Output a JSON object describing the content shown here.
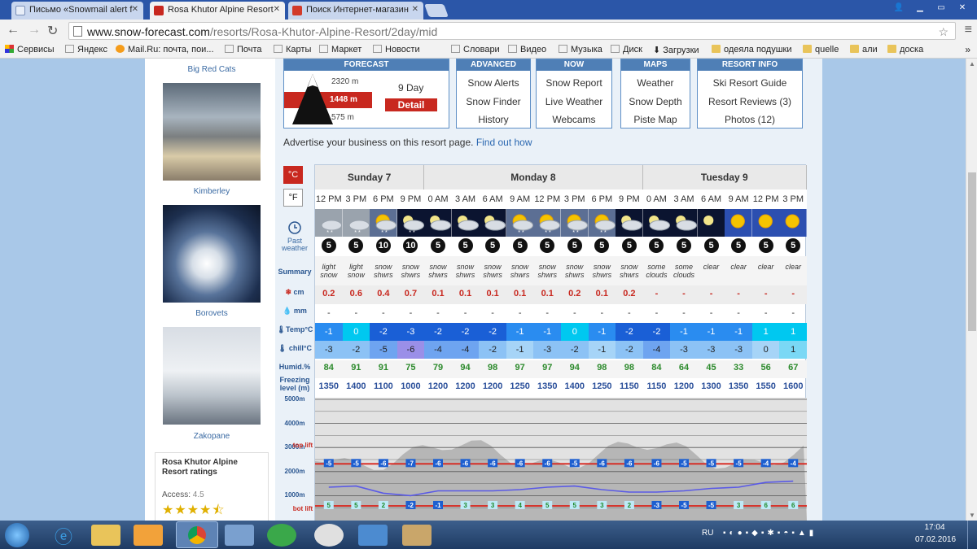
{
  "browser": {
    "tabs": [
      {
        "title": "Письмо «Snowmail alert f",
        "active": false
      },
      {
        "title": "Rosa Khutor Alpine Resort",
        "active": true
      },
      {
        "title": "Поиск Интернет-магазин",
        "active": false
      }
    ],
    "url_host": "www.snow-forecast.com",
    "url_path": "/resorts/Rosa-Khutor-Alpine-Resort/2day/mid",
    "bookmarks": [
      "Сервисы",
      "Яндекс",
      "Mail.Ru: почта, пои...",
      "Почта",
      "Карты",
      "Маркет",
      "Новости",
      "Словари",
      "Видео",
      "Музыка",
      "Диск",
      "Загрузки",
      "одеяла подушки",
      "quelle",
      "али",
      "доска"
    ]
  },
  "sidebar": {
    "links": [
      "Big Red Cats",
      "Kimberley",
      "Borovets",
      "Zakopane"
    ],
    "ratings_title": "Rosa Khutor Alpine Resort ratings",
    "access_label": "Access:",
    "access_value": "4.5",
    "access_stars": 4.5
  },
  "menu": {
    "forecast": {
      "head": "FORECAST",
      "top": "2320 m",
      "mid": "1448 m",
      "bot": "575 m",
      "nine_day": "9 Day",
      "detail": "Detail"
    },
    "advanced": {
      "head": "ADVANCED",
      "items": [
        "Snow Alerts",
        "Snow Finder",
        "History"
      ]
    },
    "now": {
      "head": "NOW",
      "items": [
        "Snow Report",
        "Live Weather",
        "Webcams"
      ]
    },
    "maps": {
      "head": "MAPS",
      "items": [
        "Weather",
        "Snow Depth",
        "Piste Map"
      ]
    },
    "resort_info": {
      "head": "RESORT INFO",
      "items": [
        "Ski Resort Guide",
        "Resort Reviews (3)",
        "Photos (12)"
      ]
    }
  },
  "advert": {
    "text": "Advertise your business on this resort page.",
    "link": "Find out how"
  },
  "units": {
    "celsius": "°C",
    "fahrenheit": "°F"
  },
  "labels": {
    "past_weather": "Past weather",
    "summary": "Summary",
    "snow": "cm",
    "rain": "mm",
    "temp": "Temp°C",
    "chill": "chill°C",
    "humid": "Humid.%",
    "freezing": "Freezing level (m)",
    "top_lift": "top lift",
    "bot_lift": "bot lift"
  },
  "days": [
    {
      "name": "Sunday 7",
      "span": 4
    },
    {
      "name": "Monday 8",
      "span": 8
    },
    {
      "name": "Tuesday 9",
      "span": 6
    }
  ],
  "forecast": {
    "times": [
      "12 PM",
      "3 PM",
      "6 PM",
      "9 PM",
      "0 AM",
      "3 AM",
      "6 AM",
      "9 AM",
      "12 PM",
      "3 PM",
      "6 PM",
      "9 PM",
      "0 AM",
      "3 AM",
      "6 AM",
      "9 AM",
      "12 PM",
      "3 PM"
    ],
    "icons": [
      "cloud-snow",
      "cloud-snow",
      "sun-cloud-snow",
      "moon-cloud-snow",
      "moon-cloud",
      "moon-cloud",
      "moon-cloud",
      "sun-cloud-snow",
      "sun-cloud-snow",
      "sun-cloud-snow",
      "sun-cloud-snow",
      "moon-cloud",
      "moon-cloud",
      "moon-cloud",
      "moon",
      "sun",
      "sun",
      "sun"
    ],
    "wind": [
      "5",
      "5",
      "10",
      "10",
      "5",
      "5",
      "5",
      "5",
      "5",
      "5",
      "5",
      "5",
      "5",
      "5",
      "5",
      "5",
      "5",
      "5"
    ],
    "summary": [
      "light snow",
      "light snow",
      "snow shwrs",
      "snow shwrs",
      "snow shwrs",
      "snow shwrs",
      "snow shwrs",
      "snow shwrs",
      "snow shwrs",
      "snow shwrs",
      "snow shwrs",
      "snow shwrs",
      "some clouds",
      "some clouds",
      "clear",
      "clear",
      "clear",
      "clear"
    ],
    "snow": [
      "0.2",
      "0.6",
      "0.4",
      "0.7",
      "0.1",
      "0.1",
      "0.1",
      "0.1",
      "0.1",
      "0.2",
      "0.1",
      "0.2",
      "-",
      "-",
      "-",
      "-",
      "-",
      "-"
    ],
    "rain": [
      "-",
      "-",
      "-",
      "-",
      "-",
      "-",
      "-",
      "-",
      "-",
      "-",
      "-",
      "-",
      "-",
      "-",
      "-",
      "-",
      "-",
      "-"
    ],
    "temp": [
      "-1",
      "0",
      "-2",
      "-3",
      "-2",
      "-2",
      "-2",
      "-1",
      "-1",
      "0",
      "-1",
      "-2",
      "-2",
      "-1",
      "-1",
      "-1",
      "1",
      "1"
    ],
    "chill": [
      "-3",
      "-2",
      "-5",
      "-6",
      "-4",
      "-4",
      "-2",
      "-1",
      "-3",
      "-2",
      "-1",
      "-2",
      "-4",
      "-3",
      "-3",
      "-3",
      "0",
      "1"
    ],
    "humid": [
      "84",
      "91",
      "91",
      "75",
      "79",
      "94",
      "98",
      "97",
      "97",
      "94",
      "98",
      "98",
      "84",
      "64",
      "45",
      "33",
      "56",
      "67"
    ],
    "freezing": [
      "1350",
      "1400",
      "1100",
      "1000",
      "1200",
      "1200",
      "1200",
      "1250",
      "1350",
      "1400",
      "1250",
      "1150",
      "1150",
      "1200",
      "1300",
      "1350",
      "1550",
      "1600"
    ],
    "top_lift_temp": [
      "-5",
      "-5",
      "-6",
      "-7",
      "-6",
      "-6",
      "-6",
      "-6",
      "-6",
      "-5",
      "-6",
      "-6",
      "-6",
      "-5",
      "-5",
      "-5",
      "-4",
      "-4"
    ],
    "bot_lift_temp": [
      "5",
      "5",
      "2",
      "-2",
      "-1",
      "3",
      "3",
      "4",
      "5",
      "5",
      "3",
      "2",
      "-3",
      "-5",
      "-5",
      "3",
      "6",
      "6"
    ]
  },
  "chart_data": {
    "type": "line",
    "title": "",
    "ylabel": "",
    "y_ticks": [
      "1000m",
      "2000m",
      "3000m",
      "4000m",
      "5000m"
    ],
    "ylim": [
      0,
      5000
    ],
    "series": [
      {
        "name": "",
        "values": [
          1350,
          1400,
          1100,
          1000,
          1200,
          1200,
          1200,
          1250,
          1350,
          1400,
          1250,
          1150,
          1150,
          1200,
          1300,
          1350,
          1550,
          1600
        ]
      }
    ],
    "top_lift_m": 2320,
    "bot_lift_m": 575
  },
  "taskbar": {
    "lang": "RU",
    "time": "17:04",
    "date": "07.02.2016"
  }
}
